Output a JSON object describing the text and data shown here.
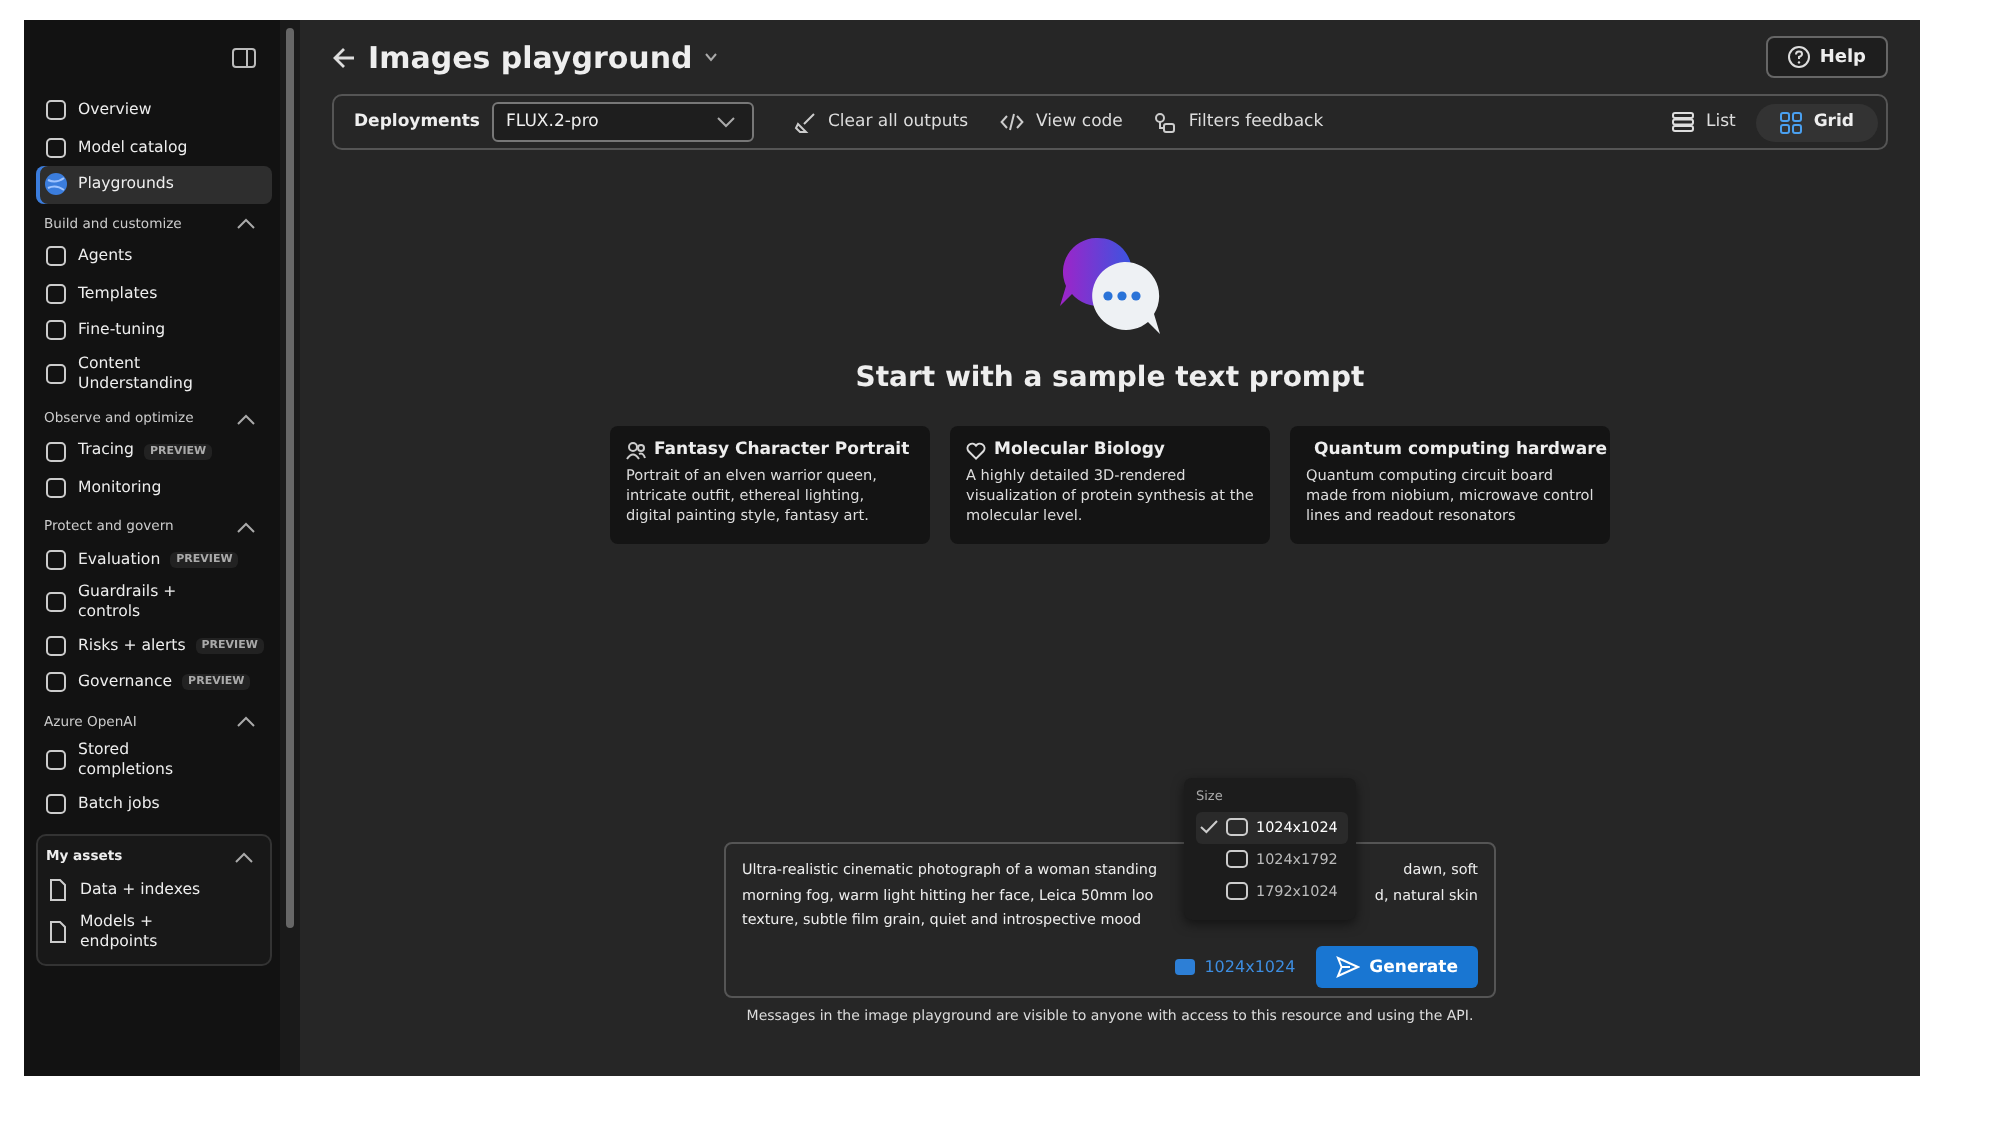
{
  "sidebar": {
    "items": [
      {
        "kind": "item",
        "label": "Overview",
        "selected": false
      },
      {
        "kind": "item",
        "label": "Model catalog",
        "selected": false
      },
      {
        "kind": "item",
        "label": "Playgrounds",
        "selected": true
      },
      {
        "kind": "section",
        "label": "Build and customize",
        "expanded": true
      },
      {
        "kind": "item",
        "label": "Agents",
        "selected": false
      },
      {
        "kind": "item",
        "label": "Templates",
        "selected": false
      },
      {
        "kind": "item",
        "label": "Fine-tuning",
        "selected": false
      },
      {
        "kind": "item",
        "label": "Content Understanding",
        "selected": false
      },
      {
        "kind": "section",
        "label": "Observe and optimize",
        "expanded": true
      },
      {
        "kind": "item",
        "label": "Tracing",
        "badge": "PREVIEW",
        "selected": false
      },
      {
        "kind": "item",
        "label": "Monitoring",
        "selected": false
      },
      {
        "kind": "section",
        "label": "Protect and govern",
        "expanded": true
      },
      {
        "kind": "item",
        "label": "Evaluation",
        "badge": "PREVIEW",
        "selected": false
      },
      {
        "kind": "item",
        "label": "Guardrails + controls",
        "selected": false
      },
      {
        "kind": "item",
        "label": "Risks + alerts",
        "badge": "PREVIEW",
        "selected": false
      },
      {
        "kind": "item",
        "label": "Governance",
        "badge": "PREVIEW",
        "selected": false
      },
      {
        "kind": "section",
        "label": "Azure OpenAI",
        "expanded": true
      },
      {
        "kind": "item",
        "label": "Stored completions",
        "selected": false
      },
      {
        "kind": "item",
        "label": "Batch jobs",
        "selected": false
      }
    ],
    "assets": {
      "label": "My assets",
      "expanded": true,
      "items": [
        "Data + indexes",
        "Models + endpoints"
      ]
    }
  },
  "header": {
    "title": "Images playground",
    "help": "Help"
  },
  "toolbar": {
    "deployments_label": "Deployments",
    "deployment": "FLUX.2-pro",
    "actions": [
      "Clear all outputs",
      "View code",
      "Filters feedback"
    ],
    "views": [
      {
        "label": "List",
        "selected": false
      },
      {
        "label": "Grid",
        "selected": true
      }
    ]
  },
  "empty_state": {
    "heading": "Start with a sample text prompt",
    "cards": [
      {
        "title": "Fantasy Character Portrait",
        "text": "Portrait of an elven warrior queen, intricate outfit, ethereal lighting, digital painting style, fantasy art."
      },
      {
        "title": "Molecular Biology",
        "text": "A highly detailed 3D-rendered visualization of protein synthesis at the molecular level."
      },
      {
        "title": "Quantum computing hardware",
        "text": "Quantum computing circuit board made from niobium, microwave control lines and readout resonators"
      }
    ]
  },
  "prompt": {
    "lines": [
      {
        "text": "Ultra-realistic cinematic photograph of a woman standing",
        "text_after": "dawn, soft"
      },
      {
        "text": "morning fog, warm light hitting her face, Leica 50mm loo",
        "text_after": "d, natural skin"
      },
      {
        "text": "texture, subtle film grain, quiet and introspective mood"
      }
    ],
    "size": "1024x1024",
    "generate": "Generate"
  },
  "size_menu": {
    "title": "Size",
    "options": [
      {
        "label": "1024x1024",
        "selected": true
      },
      {
        "label": "1024x1792",
        "selected": false
      },
      {
        "label": "1792x1024",
        "selected": false
      }
    ]
  },
  "footer_note": "Messages in the image playground are visible to anyone with access to this resource and using the API."
}
